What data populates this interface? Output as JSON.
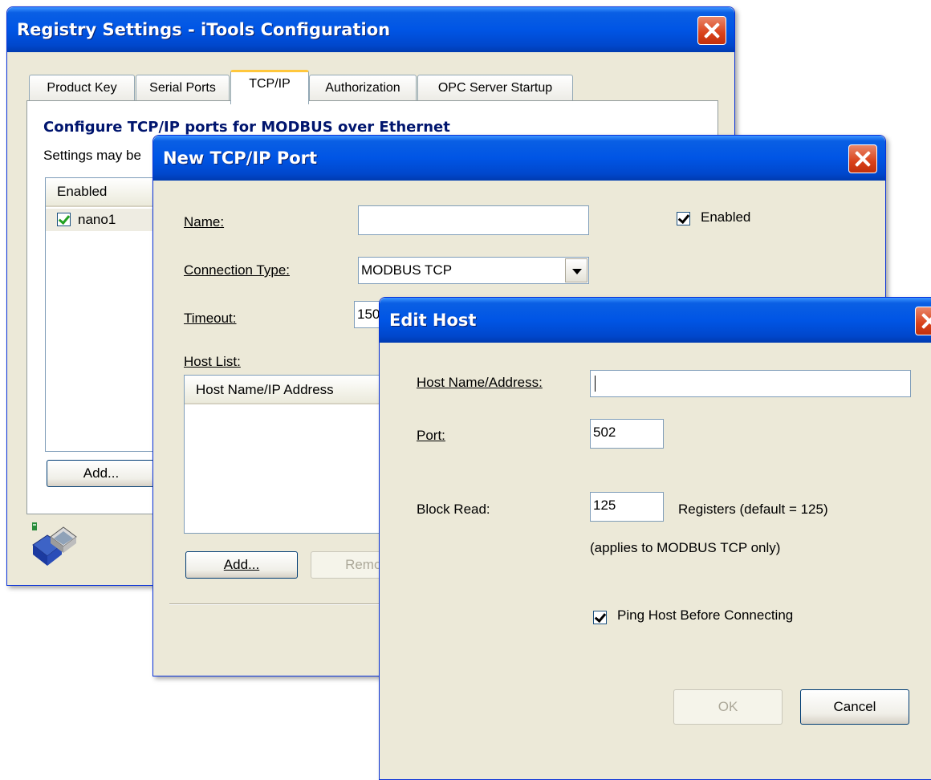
{
  "registry": {
    "title": "Registry Settings - iTools Configuration",
    "tabs": [
      {
        "label": "Product Key"
      },
      {
        "label": "Serial Ports"
      },
      {
        "label": "TCP/IP"
      },
      {
        "label": "Authorization"
      },
      {
        "label": "OPC Server Startup"
      }
    ],
    "heading": "Configure TCP/IP ports for MODBUS over Ethernet",
    "info_text": "Settings may be",
    "list_header": "Enabled",
    "list_items": [
      {
        "name": "nano1",
        "enabled": true
      }
    ],
    "add_button": "Add..."
  },
  "new_port": {
    "title": "New TCP/IP Port",
    "name_label": "Name:",
    "name_value": "",
    "enabled_label": "Enabled",
    "enabled_checked": true,
    "conn_type_label": "Connection Type:",
    "conn_type_value": "MODBUS TCP",
    "timeout_label": "Timeout:",
    "timeout_value": "150",
    "host_list_label": "Host List:",
    "host_list_header": "Host Name/IP Address",
    "add_button": "Add...",
    "remove_button": "Remov"
  },
  "edit_host": {
    "title": "Edit Host",
    "host_label": "Host Name/Address:",
    "host_value": "",
    "port_label": "Port:",
    "port_value": "502",
    "block_read_label": "Block Read:",
    "block_read_value": "125",
    "registers_note": "Registers (default = 125)",
    "applies_note": "(applies to MODBUS TCP only)",
    "ping_label": "Ping Host Before Connecting",
    "ping_checked": true,
    "ok_button": "OK",
    "cancel_button": "Cancel"
  }
}
